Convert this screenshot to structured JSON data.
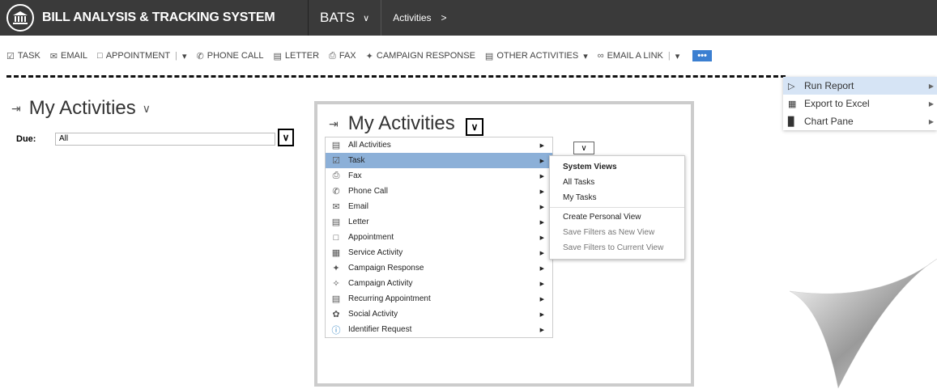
{
  "topnav": {
    "system_title": "BILL ANALYSIS & TRACKING SYSTEM",
    "app_name": "BATS",
    "breadcrumb": "Activities"
  },
  "command_bar": {
    "items": [
      {
        "label": "TASK",
        "icon": "task-checkbox-icon"
      },
      {
        "label": "EMAIL",
        "icon": "email-icon"
      },
      {
        "label": "APPOINTMENT",
        "icon": "appointment-icon"
      },
      {
        "label": "PHONE CALL",
        "icon": "phone-icon"
      },
      {
        "label": "LETTER",
        "icon": "letter-icon"
      },
      {
        "label": "FAX",
        "icon": "fax-icon"
      },
      {
        "label": "CAMPAIGN RESPONSE",
        "icon": "campaign-response-icon"
      },
      {
        "label": "OTHER ACTIVITIES",
        "icon": "other-activities-icon"
      },
      {
        "label": "EMAIL A LINK",
        "icon": "link-icon"
      }
    ],
    "more_label": "•••"
  },
  "overflow_menu": {
    "items": [
      {
        "label": "Run Report",
        "icon": "run-report-icon"
      },
      {
        "label": "Export to Excel",
        "icon": "excel-icon"
      },
      {
        "label": "Chart Pane",
        "icon": "chart-icon"
      }
    ]
  },
  "main": {
    "title": "My Activities",
    "due_label": "Due:",
    "due_value": "All"
  },
  "inset": {
    "title": "My Activities",
    "activity_menu": [
      {
        "label": "All Activities",
        "icon": "all-activities-icon"
      },
      {
        "label": "Task",
        "icon": "task-icon"
      },
      {
        "label": "Fax",
        "icon": "fax-icon"
      },
      {
        "label": "Phone Call",
        "icon": "phone-icon"
      },
      {
        "label": "Email",
        "icon": "email-icon"
      },
      {
        "label": "Letter",
        "icon": "letter-icon"
      },
      {
        "label": "Appointment",
        "icon": "appointment-icon"
      },
      {
        "label": "Service Activity",
        "icon": "service-activity-icon"
      },
      {
        "label": "Campaign Response",
        "icon": "campaign-response-icon"
      },
      {
        "label": "Campaign Activity",
        "icon": "campaign-activity-icon"
      },
      {
        "label": "Recurring Appointment",
        "icon": "recurring-appointment-icon"
      },
      {
        "label": "Social Activity",
        "icon": "social-activity-icon"
      },
      {
        "label": "Identifier Request",
        "icon": "info-icon"
      }
    ],
    "submenu": {
      "header": "System Views",
      "items": [
        "All Tasks",
        "My Tasks"
      ],
      "actions": [
        "Create Personal View",
        "Save Filters as New View",
        "Save Filters to Current View"
      ]
    }
  },
  "colors": {
    "topnav_bg": "#3a3a3a",
    "selected_item": "#8cb0d8",
    "more_button": "#3b7fd1"
  }
}
